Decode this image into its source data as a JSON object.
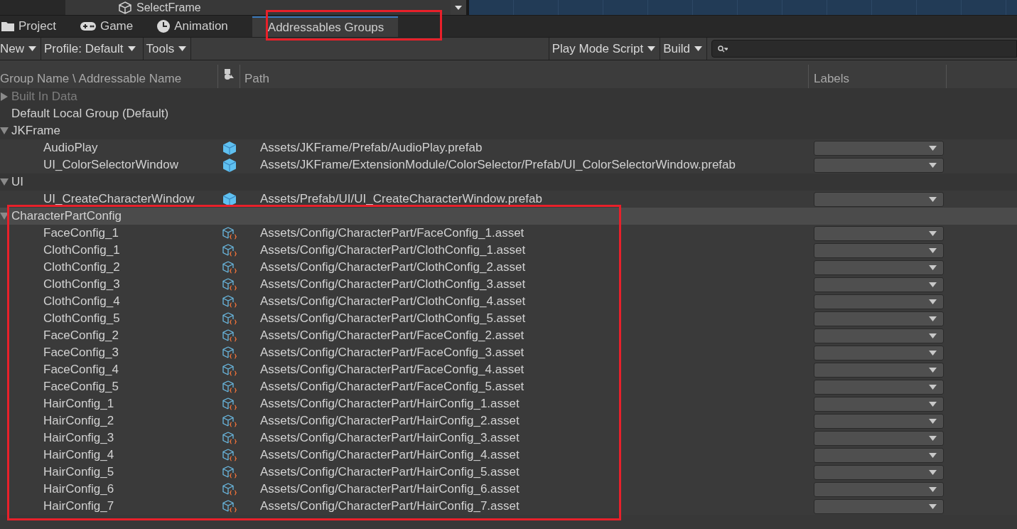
{
  "hierarchy_row": {
    "label": "SelectFrame"
  },
  "tabs": [
    {
      "label": "Project",
      "selected": false
    },
    {
      "label": "Game",
      "selected": false
    },
    {
      "label": "Animation",
      "selected": false
    },
    {
      "label": "Addressables Groups",
      "selected": true
    }
  ],
  "toolbar": {
    "left": [
      "New",
      "Profile: Default",
      "Tools"
    ],
    "right": [
      "Play Mode Script",
      "Build"
    ]
  },
  "table": {
    "columns": [
      "Group Name \\ Addressable Name",
      "Path",
      "Labels"
    ],
    "groups": [
      {
        "name": "Built In Data",
        "expanded": false,
        "disabled": true,
        "selected": false
      },
      {
        "name": "Default Local Group (Default)",
        "disabled": false,
        "selected": false
      },
      {
        "name": "JKFrame",
        "expanded": true,
        "disabled": false,
        "selected": false,
        "children": [
          {
            "name": "AudioPlay",
            "kind": "prefab",
            "path": "Assets/JKFrame/Prefab/AudioPlay.prefab"
          },
          {
            "name": "UI_ColorSelectorWindow",
            "kind": "prefab",
            "path": "Assets/JKFrame/ExtensionModule/ColorSelector/Prefab/UI_ColorSelectorWindow.prefab"
          }
        ]
      },
      {
        "name": "UI",
        "expanded": true,
        "disabled": false,
        "selected": false,
        "children": [
          {
            "name": "UI_CreateCharacterWindow",
            "kind": "prefab",
            "path": "Assets/Prefab/UI/UI_CreateCharacterWindow.prefab"
          }
        ]
      },
      {
        "name": "CharacterPartConfig",
        "expanded": true,
        "disabled": false,
        "selected": true,
        "children": [
          {
            "name": "FaceConfig_1",
            "kind": "asset",
            "path": "Assets/Config/CharacterPart/FaceConfig_1.asset"
          },
          {
            "name": "ClothConfig_1",
            "kind": "asset",
            "path": "Assets/Config/CharacterPart/ClothConfig_1.asset"
          },
          {
            "name": "ClothConfig_2",
            "kind": "asset",
            "path": "Assets/Config/CharacterPart/ClothConfig_2.asset"
          },
          {
            "name": "ClothConfig_3",
            "kind": "asset",
            "path": "Assets/Config/CharacterPart/ClothConfig_3.asset"
          },
          {
            "name": "ClothConfig_4",
            "kind": "asset",
            "path": "Assets/Config/CharacterPart/ClothConfig_4.asset"
          },
          {
            "name": "ClothConfig_5",
            "kind": "asset",
            "path": "Assets/Config/CharacterPart/ClothConfig_5.asset"
          },
          {
            "name": "FaceConfig_2",
            "kind": "asset",
            "path": "Assets/Config/CharacterPart/FaceConfig_2.asset"
          },
          {
            "name": "FaceConfig_3",
            "kind": "asset",
            "path": "Assets/Config/CharacterPart/FaceConfig_3.asset"
          },
          {
            "name": "FaceConfig_4",
            "kind": "asset",
            "path": "Assets/Config/CharacterPart/FaceConfig_4.asset"
          },
          {
            "name": "FaceConfig_5",
            "kind": "asset",
            "path": "Assets/Config/CharacterPart/FaceConfig_5.asset"
          },
          {
            "name": "HairConfig_1",
            "kind": "asset",
            "path": "Assets/Config/CharacterPart/HairConfig_1.asset"
          },
          {
            "name": "HairConfig_2",
            "kind": "asset",
            "path": "Assets/Config/CharacterPart/HairConfig_2.asset"
          },
          {
            "name": "HairConfig_3",
            "kind": "asset",
            "path": "Assets/Config/CharacterPart/HairConfig_3.asset"
          },
          {
            "name": "HairConfig_4",
            "kind": "asset",
            "path": "Assets/Config/CharacterPart/HairConfig_4.asset"
          },
          {
            "name": "HairConfig_5",
            "kind": "asset",
            "path": "Assets/Config/CharacterPart/HairConfig_5.asset"
          },
          {
            "name": "HairConfig_6",
            "kind": "asset",
            "path": "Assets/Config/CharacterPart/HairConfig_6.asset"
          },
          {
            "name": "HairConfig_7",
            "kind": "asset",
            "path": "Assets/Config/CharacterPart/HairConfig_7.asset"
          }
        ]
      }
    ]
  }
}
